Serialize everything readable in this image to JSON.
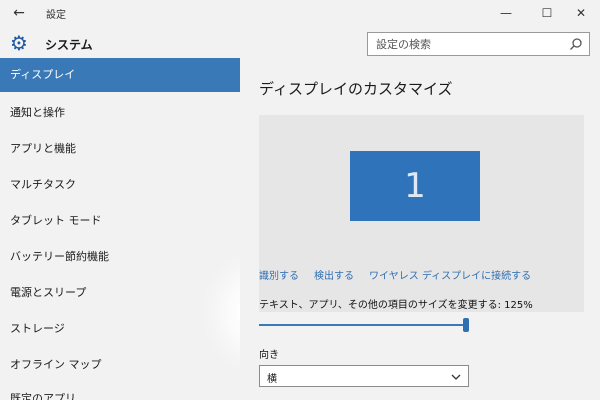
{
  "window": {
    "title": "設定",
    "back_icon": "back-arrow-icon",
    "min_label": "—",
    "max_label": "☐",
    "close_label": "✕"
  },
  "header": {
    "section_title": "システム",
    "icon": "gear-icon",
    "search_placeholder": "設定の検索"
  },
  "sidebar": {
    "items": [
      {
        "label": "ディスプレイ",
        "active": true
      },
      {
        "label": "通知と操作"
      },
      {
        "label": "アプリと機能"
      },
      {
        "label": "マルチタスク"
      },
      {
        "label": "タブレット モード"
      },
      {
        "label": "バッテリー節約機能"
      },
      {
        "label": "電源とスリープ"
      },
      {
        "label": "ストレージ"
      },
      {
        "label": "オフライン マップ"
      },
      {
        "label": "既定のアプリ"
      }
    ]
  },
  "main": {
    "title": "ディスプレイのカスタマイズ",
    "monitor_number": "1",
    "links": [
      "識別する",
      "検出する",
      "ワイヤレス ディスプレイに接続する"
    ],
    "scale_label": "テキスト、アプリ、その他の項目のサイズを変更する: 125%",
    "scale_value_percent": 125,
    "slider_fraction": 1.0,
    "orientation_label": "向き",
    "orientation_value": "横"
  },
  "colors": {
    "accent": "#3a79b8",
    "monitor": "#2f74bb",
    "link": "#2f6fb2"
  }
}
